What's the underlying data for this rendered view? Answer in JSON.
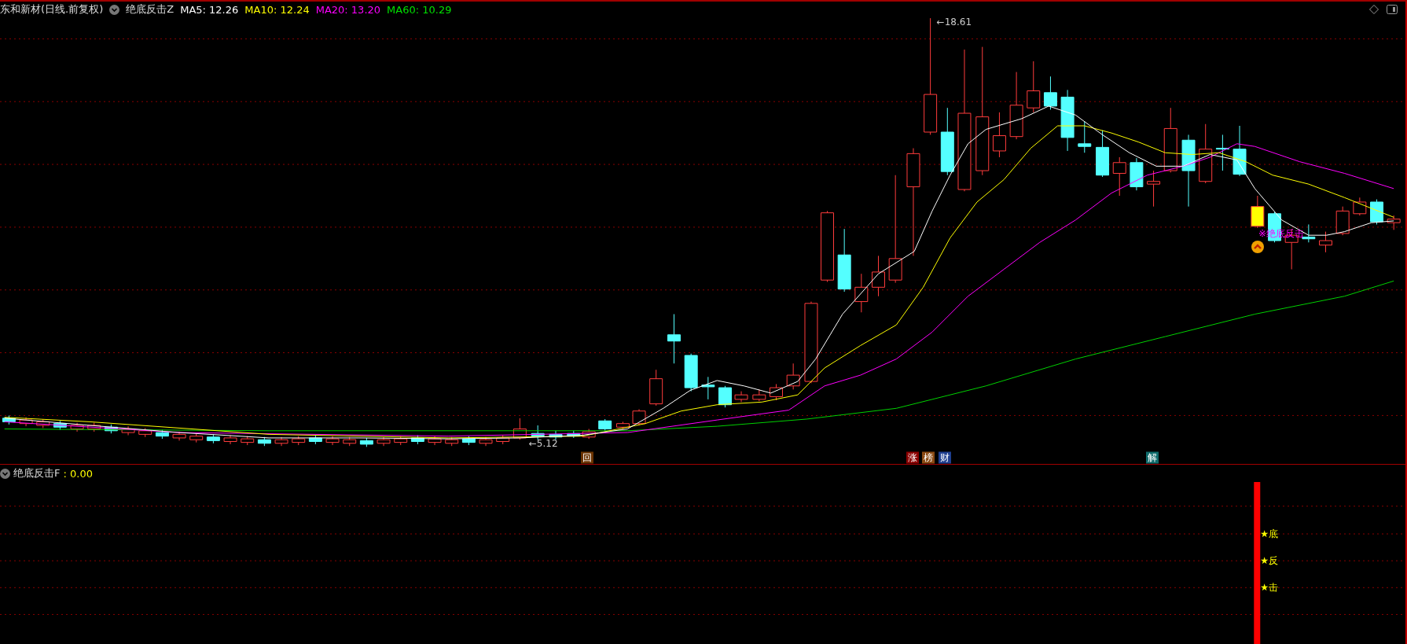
{
  "header": {
    "title": "东和新材(日线.前复权)",
    "indicator": "绝底反击Z",
    "averages": [
      {
        "label": "MA5: 12.26",
        "color": "#ffffff"
      },
      {
        "label": "MA10: 12.24",
        "color": "#ffff00"
      },
      {
        "label": "MA20: 13.20",
        "color": "#ff00ff"
      },
      {
        "label": "MA60: 10.29",
        "color": "#00e000"
      }
    ]
  },
  "main_chart": {
    "price_labels": [
      "←18.61",
      "←5.12"
    ],
    "signal": "※绝底反击",
    "events": [
      {
        "text": "回",
        "color": "#6b3300"
      },
      {
        "text": "涨",
        "color": "#8b0000"
      },
      {
        "text": "榜",
        "color": "#8b4a13"
      },
      {
        "text": "财",
        "color": "#1f3f8f"
      },
      {
        "text": "解",
        "color": "#0f6b6b"
      }
    ]
  },
  "sub_chart": {
    "indicator": "绝底反击F",
    "value": ": 0.00",
    "signals": [
      "★底",
      "★反",
      "★击"
    ]
  }
}
